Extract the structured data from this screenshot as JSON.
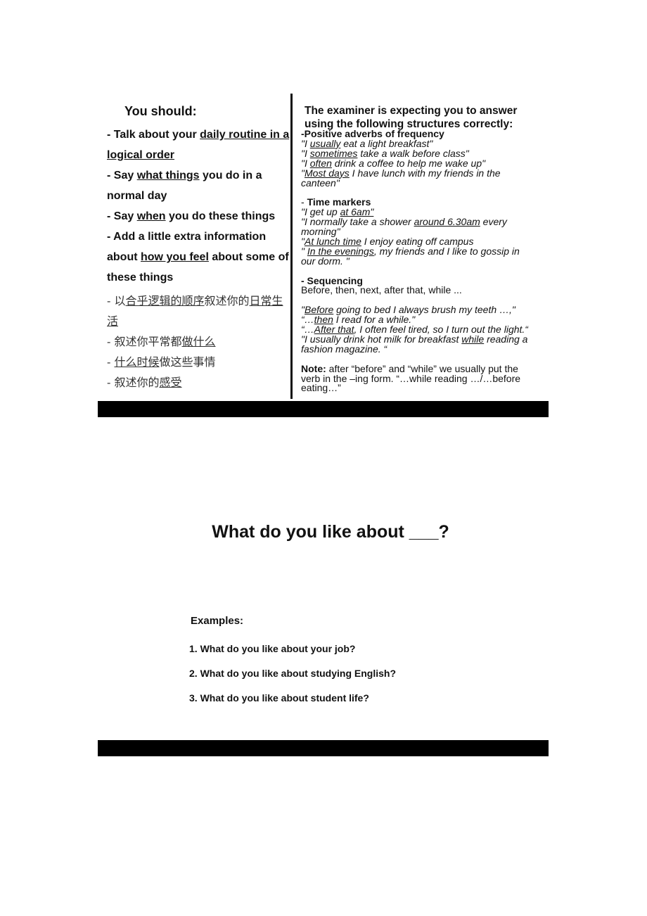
{
  "left": {
    "heading": "You should:",
    "lines": [
      [
        {
          "t": "- Talk about your "
        },
        {
          "t": "daily routine in a",
          "u": 1
        }
      ],
      [
        {
          "t": "logical order",
          "u": 1
        }
      ],
      [
        {
          "t": "- Say "
        },
        {
          "t": "what things",
          "u": 1
        },
        {
          "t": " you do in a"
        }
      ],
      [
        {
          "t": "normal day"
        }
      ],
      [
        {
          "t": "- Say "
        },
        {
          "t": "when",
          "u": 1
        },
        {
          "t": " you do these things"
        }
      ],
      [
        {
          "t": "- Add a little extra information"
        }
      ],
      [
        {
          "t": "about "
        },
        {
          "t": "how you feel",
          "u": 1
        },
        {
          "t": " about some of"
        }
      ],
      [
        {
          "t": "these things"
        }
      ]
    ],
    "chinese_lines": [
      [
        {
          "t": "- 以"
        },
        {
          "t": "合乎逻辑的顺序",
          "u": 1
        },
        {
          "t": "叙述你的"
        },
        {
          "t": "日常生",
          "u": 1
        }
      ],
      [
        {
          "t": "活",
          "u": 1
        }
      ],
      [
        {
          "t": "- 叙述你平常都"
        },
        {
          "t": "做什么",
          "u": 1
        }
      ],
      [
        {
          "t": "- "
        },
        {
          "t": "什么时候",
          "u": 1
        },
        {
          "t": "做这些事情"
        }
      ],
      [
        {
          "t": "- 叙述你的"
        },
        {
          "t": "感受",
          "u": 1
        }
      ]
    ]
  },
  "right": {
    "heading_line1": "The examiner is expecting you to answer",
    "heading_line2": "using the following structures correctly:",
    "lines": [
      [
        {
          "t": "-Positive adverbs of frequency",
          "b": 1
        }
      ],
      [
        {
          "t": "\"I ",
          "i": 1
        },
        {
          "t": "usually",
          "i": 1,
          "u": 1
        },
        {
          "t": " eat a light breakfast\"",
          "i": 1
        }
      ],
      [
        {
          "t": "\"I ",
          "i": 1
        },
        {
          "t": "sometimes",
          "i": 1,
          "u": 1
        },
        {
          "t": " take a walk before class\"",
          "i": 1
        }
      ],
      [
        {
          "t": "\"I ",
          "i": 1
        },
        {
          "t": "often",
          "i": 1,
          "u": 1
        },
        {
          "t": " drink a coffee to help me wake up\"",
          "i": 1
        }
      ],
      [
        {
          "t": "\"",
          "i": 1
        },
        {
          "t": "Most days",
          "i": 1,
          "u": 1
        },
        {
          "t": " I have lunch with my friends in the",
          "i": 1
        }
      ],
      [
        {
          "t": "canteen\"",
          "i": 1
        }
      ],
      [
        {
          "t": ""
        }
      ],
      [
        {
          "t": "- "
        },
        {
          "t": "Time markers",
          "b": 1
        }
      ],
      [
        {
          "t": "\"I get up ",
          "i": 1
        },
        {
          "t": "at 6am\"",
          "i": 1,
          "u": 1
        }
      ],
      [
        {
          "t": "\"I normally take a shower ",
          "i": 1
        },
        {
          "t": "around 6.30am",
          "i": 1,
          "u": 1
        },
        {
          "t": " every",
          "i": 1
        }
      ],
      [
        {
          "t": "morning\"",
          "i": 1
        }
      ],
      [
        {
          "t": "\"",
          "i": 1
        },
        {
          "t": "At lunch time",
          "i": 1,
          "u": 1
        },
        {
          "t": " I enjoy eating off campus",
          "i": 1
        }
      ],
      [
        {
          "t": "\" ",
          "i": 1
        },
        {
          "t": "In the evenings",
          "i": 1,
          "u": 1
        },
        {
          "t": ", my friends and I like to gossip in",
          "i": 1
        }
      ],
      [
        {
          "t": "our dorm. \"",
          "i": 1
        }
      ],
      [
        {
          "t": ""
        }
      ],
      [
        {
          "t": "- Sequencing",
          "b": 1
        }
      ],
      [
        {
          "t": "Before, then, next, after that, while ..."
        }
      ],
      [
        {
          "t": ""
        }
      ],
      [
        {
          "t": "\"",
          "i": 1
        },
        {
          "t": "Before",
          "i": 1,
          "u": 1
        },
        {
          "t": " going to bed I always brush my teeth …,\"",
          "i": 1
        }
      ],
      [
        {
          "t": "“…",
          "i": 1
        },
        {
          "t": "then",
          "i": 1,
          "u": 1
        },
        {
          "t": " I read for a while.\"",
          "i": 1
        }
      ],
      [
        {
          "t": "“…",
          "i": 1
        },
        {
          "t": "After that",
          "i": 1,
          "u": 1
        },
        {
          "t": ", I often feel tired, so I turn out the light.“",
          "i": 1
        }
      ],
      [
        {
          "t": " \"I usually drink hot milk for breakfast ",
          "i": 1
        },
        {
          "t": "while",
          "i": 1,
          "u": 1
        },
        {
          "t": " reading a",
          "i": 1
        }
      ],
      [
        {
          "t": "fashion magazine. “",
          "i": 1
        }
      ],
      [
        {
          "t": ""
        }
      ],
      [
        {
          "t": "Note:",
          "b": 1
        },
        {
          "t": " after “before” and “while” we usually put the"
        }
      ],
      [
        {
          "t": "verb in the –ing form. “…while reading …/…before"
        }
      ],
      [
        {
          "t": "eating…”"
        }
      ]
    ]
  },
  "section2": {
    "title": "What do you like about ___?",
    "examples_label": "Examples:",
    "examples": [
      "1. What do you like about your job?",
      "2. What do you like about studying English?",
      "3. What do you like about student life?"
    ]
  }
}
